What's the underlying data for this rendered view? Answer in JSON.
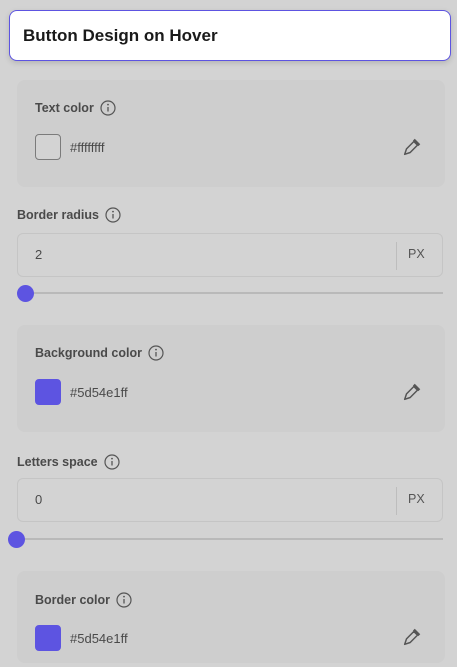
{
  "header": {
    "title": "Button Design on Hover"
  },
  "text_color": {
    "label": "Text color",
    "hex": "#ffffffff",
    "swatch": "#d3d3d3"
  },
  "border_radius": {
    "label": "Border radius",
    "value": "2",
    "unit": "PX",
    "slider_fraction": 0.02
  },
  "background_color": {
    "label": "Background color",
    "hex": "#5d54e1ff",
    "swatch": "#5d54e1"
  },
  "letters_space": {
    "label": "Letters space",
    "value": "0",
    "unit": "PX",
    "slider_fraction": 0
  },
  "border_color": {
    "label": "Border color",
    "hex": "#5d54e1ff",
    "swatch": "#5d54e1"
  },
  "icons": {
    "info": "info-icon",
    "picker": "eyedropper-icon"
  },
  "colors": {
    "accent": "#5d54e1"
  }
}
